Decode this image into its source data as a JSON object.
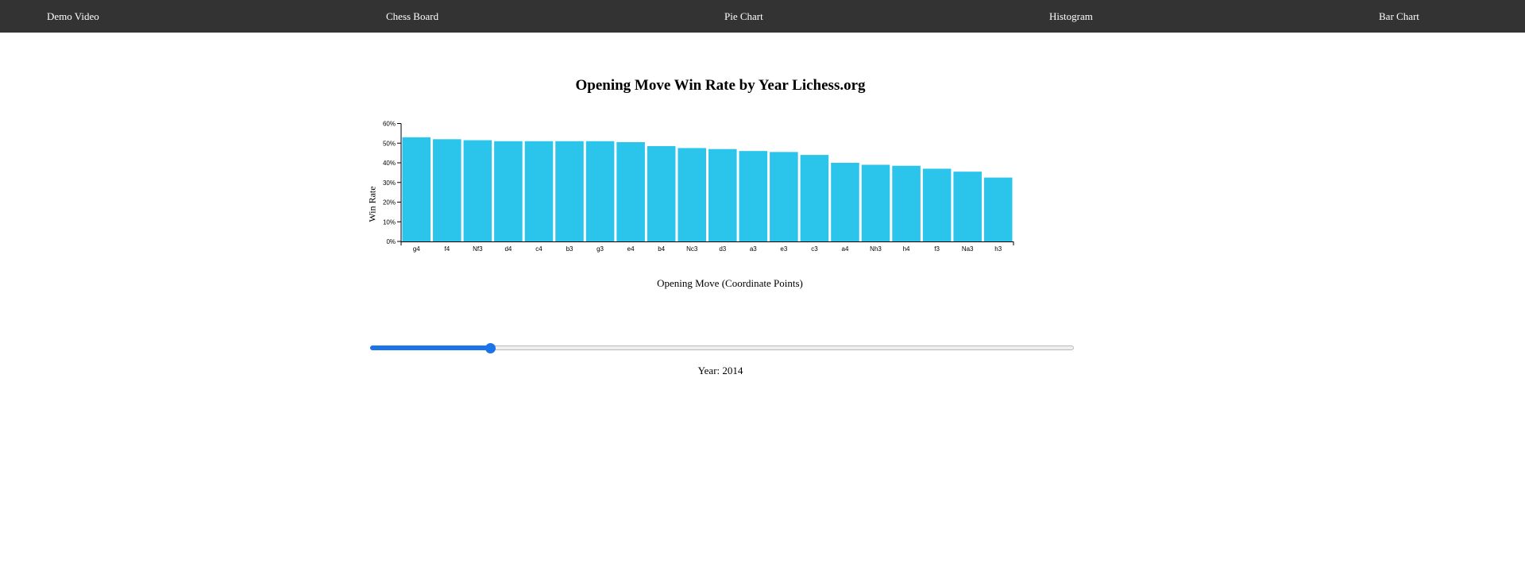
{
  "nav": {
    "items": [
      "Demo Video",
      "Chess Board",
      "Pie Chart",
      "Histogram",
      "Bar Chart"
    ]
  },
  "colors": {
    "navbar_bg": "#333333",
    "bar": "#2bc4ea",
    "slider_accent": "#1a73e8"
  },
  "year_control": {
    "label": "Year: 2014",
    "fill_fraction": 0.17
  },
  "chart_data": {
    "type": "bar",
    "title": "Opening Move Win Rate by Year Lichess.org",
    "xlabel": "Opening Move (Coordinate Points)",
    "ylabel": "Win Rate",
    "ylim": [
      0,
      60
    ],
    "yticks": [
      "0%",
      "10%",
      "20%",
      "30%",
      "40%",
      "50%",
      "60%"
    ],
    "categories": [
      "g4",
      "f4",
      "Nf3",
      "d4",
      "c4",
      "b3",
      "g3",
      "e4",
      "b4",
      "Nc3",
      "d3",
      "a3",
      "e3",
      "c3",
      "a4",
      "Nh3",
      "h4",
      "f3",
      "Na3",
      "h3"
    ],
    "values": [
      53,
      52,
      51.5,
      51,
      51,
      51,
      51,
      50.5,
      48.5,
      47.5,
      47,
      46,
      45.5,
      44,
      40,
      39,
      38.5,
      37,
      35.5,
      32.5
    ],
    "grid": false,
    "legend": "none"
  }
}
